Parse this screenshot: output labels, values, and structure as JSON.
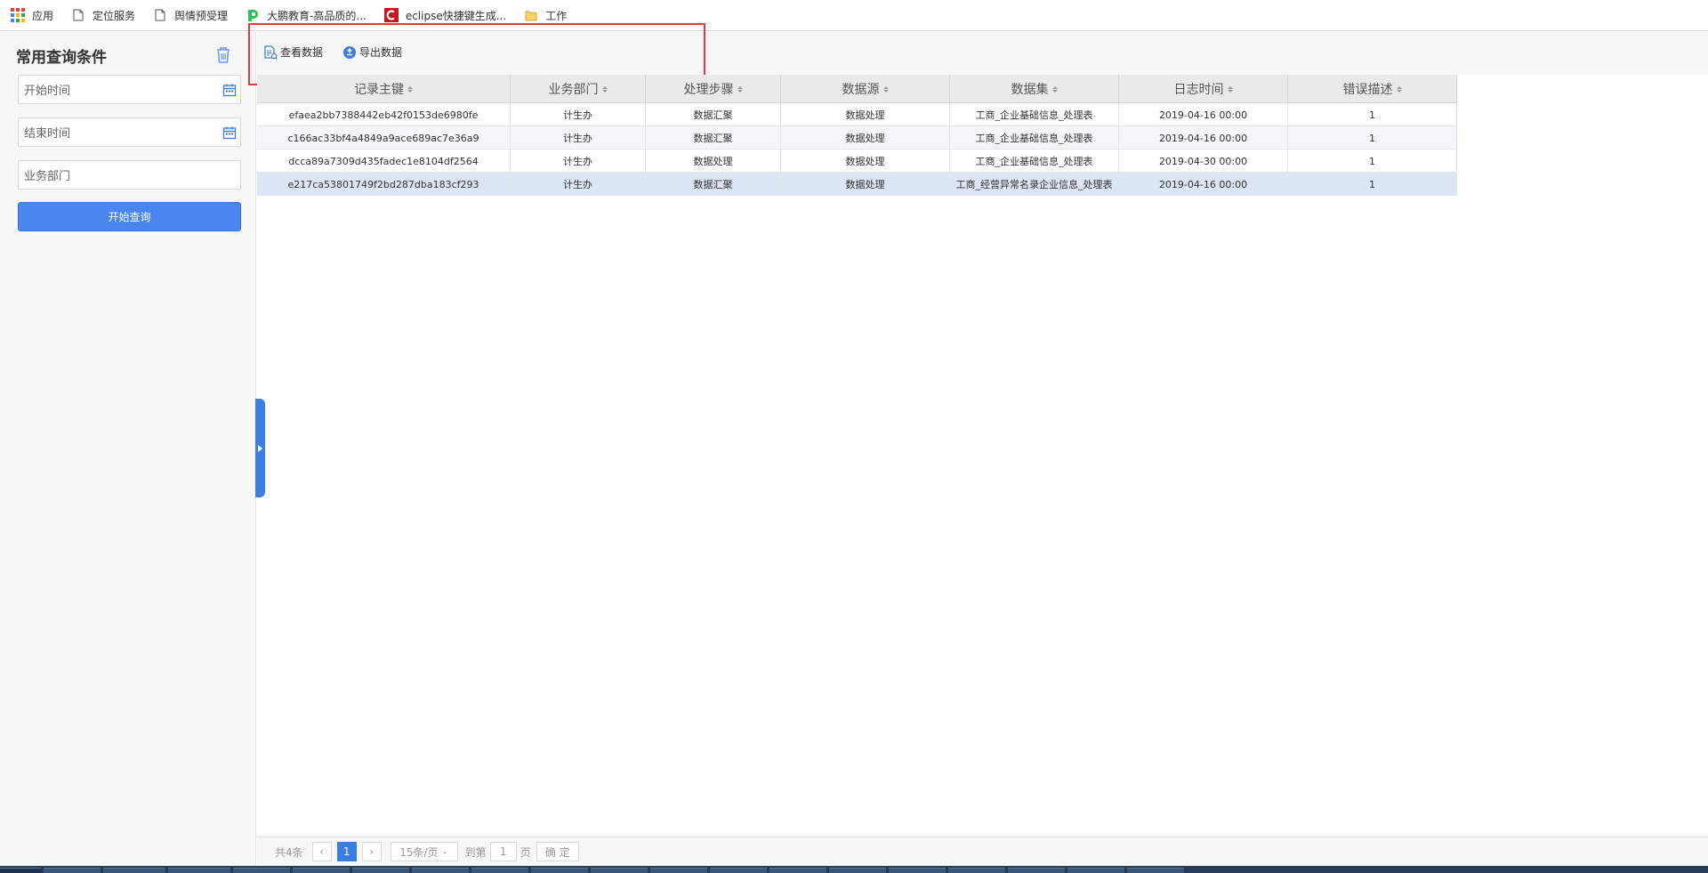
{
  "bookmarks": [
    {
      "label": "应用",
      "icon": "apps-grid-icon"
    },
    {
      "label": "定位服务",
      "icon": "page-icon"
    },
    {
      "label": "舆情预受理",
      "icon": "page-icon"
    },
    {
      "label": "大鹏教育-高品质的...",
      "icon": "dapeng-logo-icon"
    },
    {
      "label": "eclipse快捷键生成...",
      "icon": "c-logo-icon"
    },
    {
      "label": "工作",
      "icon": "folder-icon"
    }
  ],
  "sidebar": {
    "title": "常用查询条件",
    "start_time": {
      "placeholder": "开始时间"
    },
    "end_time": {
      "placeholder": "结束时间"
    },
    "department": {
      "placeholder": "业务部门"
    },
    "query_button": "开始查询"
  },
  "toolbar": {
    "view_data": "查看数据",
    "export_data": "导出数据"
  },
  "table": {
    "columns": [
      "记录主键",
      "业务部门",
      "处理步骤",
      "数据源",
      "数据集",
      "日志时间",
      "错误描述"
    ],
    "rows": [
      [
        "efaea2bb7388442eb42f0153de6980fe",
        "计生办",
        "数据汇聚",
        "数据处理",
        "工商_企业基础信息_处理表",
        "2019-04-16 00:00",
        "1"
      ],
      [
        "c166ac33bf4a4849a9ace689ac7e36a9",
        "计生办",
        "数据汇聚",
        "数据处理",
        "工商_企业基础信息_处理表",
        "2019-04-16 00:00",
        "1"
      ],
      [
        "dcca89a7309d435fadec1e8104df2564",
        "计生办",
        "数据处理",
        "数据处理",
        "工商_企业基础信息_处理表",
        "2019-04-30 00:00",
        "1"
      ],
      [
        "e217ca53801749f2bd287dba183cf293",
        "计生办",
        "数据汇聚",
        "数据处理",
        "工商_经营异常名录企业信息_处理表",
        "2019-04-16 00:00",
        "1"
      ]
    ]
  },
  "pager": {
    "total": "共4条",
    "prev": "‹",
    "current_page": "1",
    "next": "›",
    "page_size": "15条/页",
    "goto_label": "到第",
    "goto_value": "1",
    "page_suffix": "页",
    "confirm": "确 定"
  },
  "colors": {
    "accent": "#4a86f0",
    "highlight_box": "#e23a3a",
    "selected_row": "#dbe6f7"
  }
}
